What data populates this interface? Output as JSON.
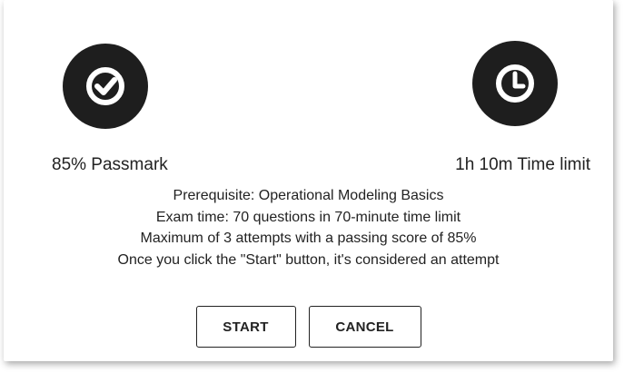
{
  "stats": {
    "passmark": {
      "icon": "check-circle-icon",
      "label": "85% Passmark"
    },
    "time_limit": {
      "icon": "clock-icon",
      "label": "1h 10m Time limit"
    }
  },
  "info_lines": [
    "Prerequisite: Operational Modeling Basics",
    "Exam time: 70 questions in 70-minute time limit",
    "Maximum of 3 attempts with a passing score of 85%",
    "Once you click the \"Start\" button, it's considered an attempt"
  ],
  "buttons": {
    "start_label": "START",
    "cancel_label": "CANCEL"
  },
  "colors": {
    "icon_background": "#1e1e1e",
    "icon_foreground": "#ffffff",
    "text": "#222222",
    "background": "#ffffff"
  }
}
